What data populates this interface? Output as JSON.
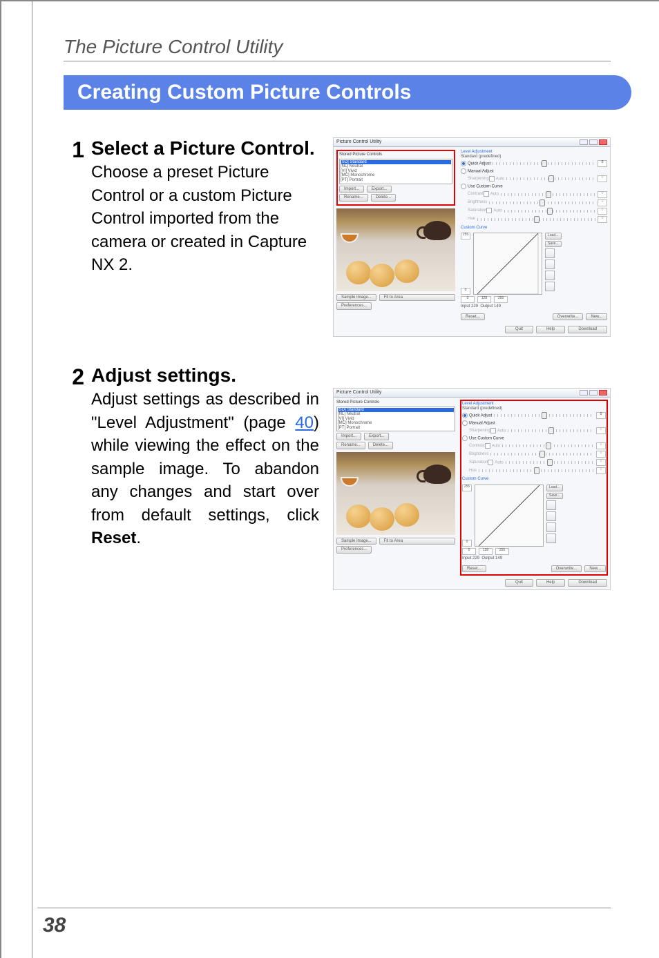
{
  "page": {
    "section_title": "The Picture Control Utility",
    "banner": "Creating  Custom Picture Controls",
    "page_number": "38"
  },
  "steps": {
    "one": {
      "num": "1",
      "title": "Select a Picture Control.",
      "text": "Choose a preset Picture Control or a custom Picture Control imported from the camera or created in Capture NX 2."
    },
    "two": {
      "num": "2",
      "title": "Adjust settings.",
      "text_a": "Adjust settings as described in \"Level Adjustment\" (page ",
      "link": "40",
      "text_b": ") while viewing the effect on the sample image. To abandon any changes and start over from default settings, click ",
      "bold": "Reset",
      "text_c": "."
    }
  },
  "shot": {
    "title": "Picture Control Utility",
    "stored_label": "Stored Picture Controls",
    "list": {
      "sd": "[SD] Standard",
      "nl": "[NL] Neutral",
      "vi": "[VI] Vivid",
      "mc": "[MC] Monochrome",
      "pt": "[PT] Portrait"
    },
    "btn_import": "Import...",
    "btn_export": "Export...",
    "btn_rename": "Rename...",
    "btn_delete": "Delete...",
    "btn_sample": "Sample Image...",
    "fit": "Fit to Area",
    "btn_prefs": "Preferences...",
    "level_heading": "Level Adjustment",
    "level_sub": "Standard (predefined)",
    "quick": "Quick Adjust",
    "manual": "Manual Adjust",
    "ucc": "Use Custom Curve",
    "sharp": "Sharpening",
    "contrast": "Contrast",
    "bright": "Brightness",
    "sat": "Saturation",
    "hue": "Hue",
    "auto": "Auto",
    "cc": "Custom Curve",
    "load": "Load...",
    "save": "Save...",
    "c255": "255",
    "c0": "0",
    "c128": "128",
    "in": "Input 229",
    "out": "Output 149",
    "reset": "Reset...",
    "overwrite": "Overwrite...",
    "new": "New...",
    "quit": "Quit",
    "help": "Help",
    "download": "Download"
  }
}
